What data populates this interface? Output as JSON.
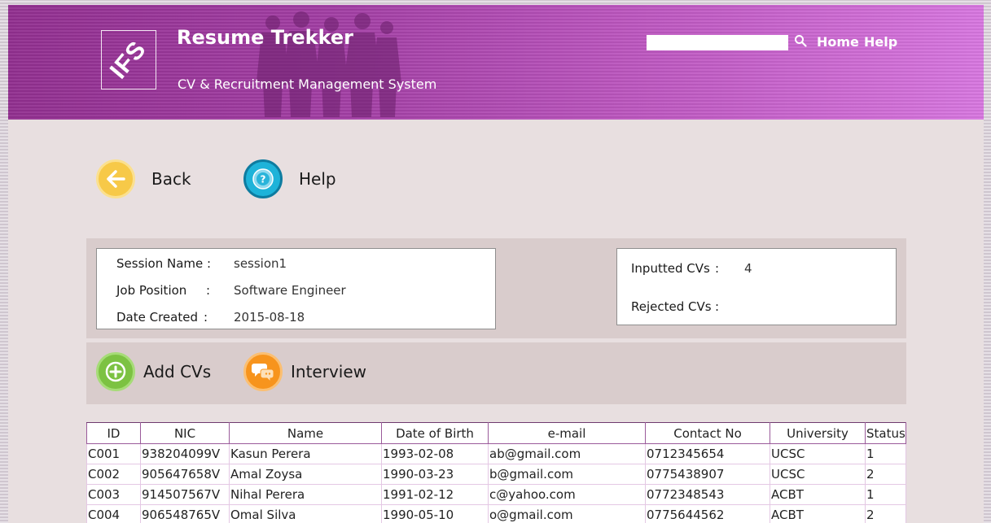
{
  "header": {
    "logo_text": "IFS",
    "title": "Resume Trekker",
    "subtitle": "CV & Recruitment Management System",
    "search": {
      "value": "",
      "placeholder": ""
    },
    "nav": {
      "home": "Home",
      "help": "Help"
    }
  },
  "top_actions": {
    "back": "Back",
    "help": "Help"
  },
  "session": {
    "name_label": "Session Name :",
    "name_value": "session1",
    "position_label": "Job Position",
    "position_colon": ":",
    "position_value": "Software Engineer",
    "date_label": "Date Created",
    "date_colon": ":",
    "date_value": "2015-08-18"
  },
  "cv_stats": {
    "inputted_label": "Inputted CVs",
    "inputted_colon": ":",
    "inputted_value": "4",
    "rejected_label": "Rejected CVs",
    "rejected_colon": ":",
    "rejected_value": ""
  },
  "mid_actions": {
    "add_cvs": "Add CVs",
    "interview": "Interview"
  },
  "table": {
    "headers": [
      "ID",
      "NIC",
      "Name",
      "Date of Birth",
      "e-mail",
      "Contact No",
      "University",
      "Status"
    ],
    "rows": [
      [
        "C001",
        "938204099V",
        "Kasun Perera",
        "1993-02-08",
        "ab@gmail.com",
        "0712345654",
        "UCSC",
        "1"
      ],
      [
        "C002",
        "905647658V",
        "Amal Zoysa",
        "1990-03-23",
        "b@gmail.com",
        "0775438907",
        "UCSC",
        "2"
      ],
      [
        "C003",
        "914507567V",
        "Nihal Perera",
        "1991-02-12",
        "c@yahoo.com",
        "0772348543",
        "ACBT",
        "1"
      ],
      [
        "C004",
        "906548765V",
        "Omal Silva",
        "1990-05-10",
        "o@gmail.com",
        "0775644562",
        "ACBT",
        "2"
      ]
    ]
  },
  "colors": {
    "header_start": "#922f90",
    "header_end": "#d877e0",
    "back_yellow": "#f7c948",
    "help_blue": "#1eb3d9",
    "add_green": "#7cc242",
    "interview_orange": "#f7941d",
    "panel_bg": "#d9cccc"
  },
  "icons": {
    "logo": "ifs-logo",
    "search": "search-icon",
    "back": "arrow-left-icon",
    "help": "question-icon",
    "add": "plus-circle-icon",
    "interview": "chat-bubbles-icon"
  }
}
